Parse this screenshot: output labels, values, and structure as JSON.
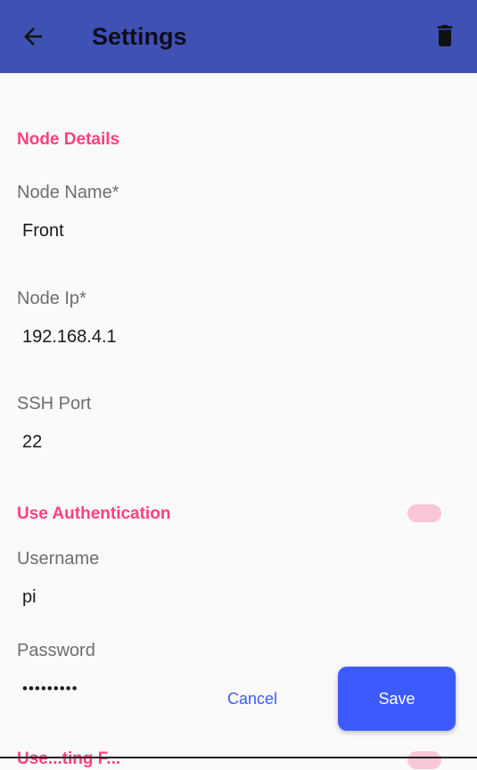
{
  "appbar": {
    "title": "Settings",
    "back_icon": "arrow-left-icon",
    "delete_icon": "trash-icon",
    "color": "#3f51b5"
  },
  "node_details": {
    "section_title": "Node Details",
    "node_name": {
      "label": "Node Name*",
      "value": "Front"
    },
    "node_ip": {
      "label": "Node Ip*",
      "value": "192.168.4.1"
    },
    "ssh_port": {
      "label": "SSH Port",
      "value": "22"
    }
  },
  "authentication": {
    "section_title": "Use Authentication",
    "toggle_on": false,
    "username": {
      "label": "Username",
      "value": "pi"
    },
    "password": {
      "label": "Password",
      "value": "•••••••••"
    }
  },
  "next_section": {
    "title": "Use...ting F..."
  },
  "actions": {
    "cancel_label": "Cancel",
    "save_label": "Save"
  },
  "colors": {
    "accent": "#ff4081",
    "primary": "#3d5afe",
    "toggle_track": "#f8c6d7"
  }
}
